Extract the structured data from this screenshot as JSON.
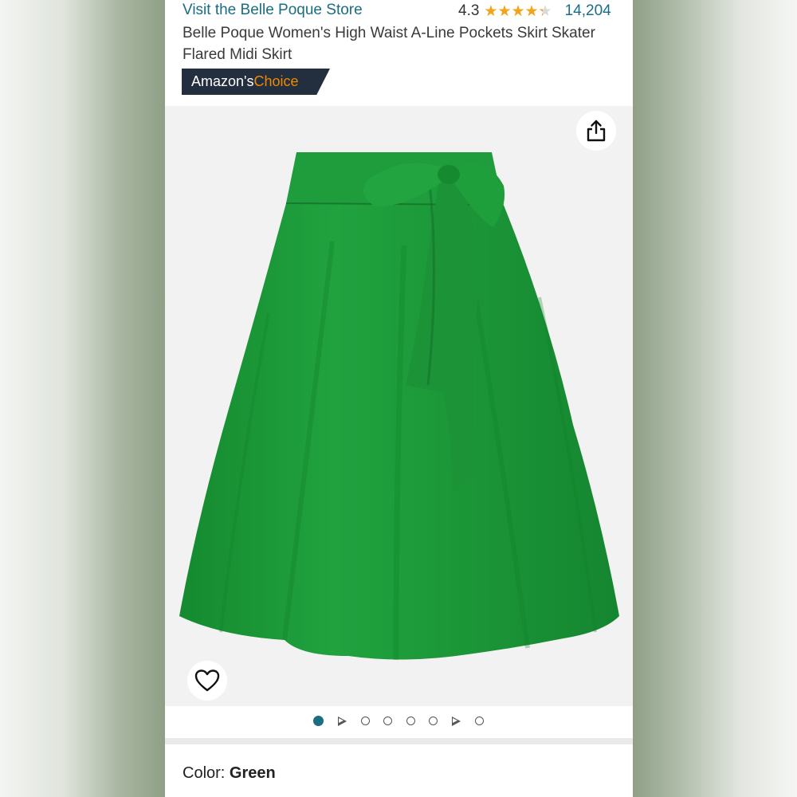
{
  "header": {
    "store_link": "Visit the Belle Poque Store",
    "rating": "4.3",
    "rating_value": 4.3,
    "rating_max": 5,
    "review_count": "14,204",
    "title": "Belle Poque Women's High Waist A-Line Pockets Skirt Skater Flared Midi Skirt",
    "badge_prefix": "Amazon's",
    "badge_accent": "Choice"
  },
  "gallery": {
    "image_name": "green-skirt-product-image",
    "image_count": 8,
    "active_index": 0
  },
  "variation": {
    "label": "Color: ",
    "value": "Green"
  },
  "colors": {
    "link": "#1a6d82",
    "star": "#f4a418",
    "badge_bg": "#232f3e",
    "badge_accent": "#f08804",
    "skirt": "#1f9a3a"
  },
  "icons": {
    "share": "share-icon",
    "wishlist": "heart-icon"
  }
}
